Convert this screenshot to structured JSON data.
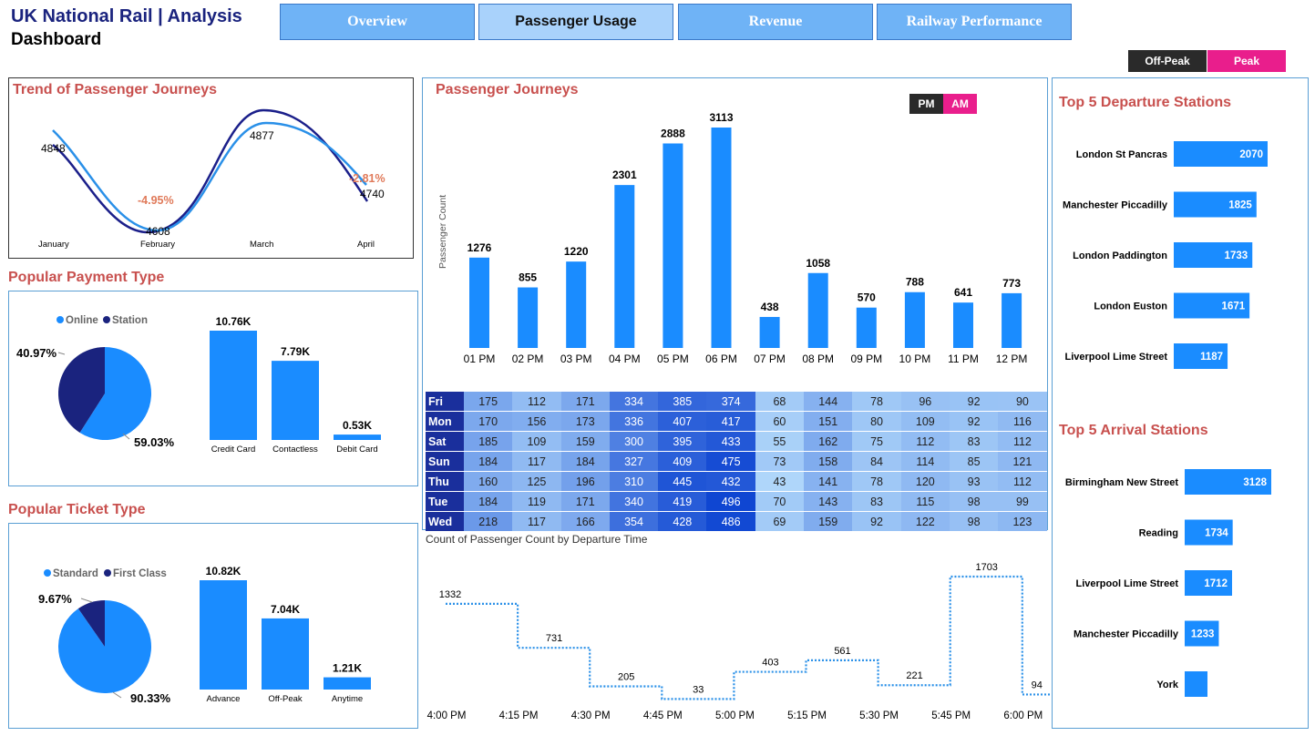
{
  "header": {
    "title_line1": "UK National Rail | Analysis",
    "title_line2": "Dashboard"
  },
  "nav": {
    "tabs": [
      {
        "label": "Overview",
        "active": false
      },
      {
        "label": "Passenger Usage",
        "active": true
      },
      {
        "label": "Revenue",
        "active": false
      },
      {
        "label": "Railway Performance",
        "active": false
      }
    ]
  },
  "peak_toggle": {
    "off_peak": "Off-Peak",
    "peak": "Peak"
  },
  "colors": {
    "accent": "#1a8cff",
    "navy": "#1a237e",
    "title_red": "#c8504e",
    "pink": "#e91e8c",
    "dark": "#2a2a2a"
  },
  "trend": {
    "title": "Trend of Passenger Journeys",
    "chart_data": {
      "type": "line",
      "categories": [
        "January",
        "February",
        "March",
        "April"
      ],
      "series": [
        {
          "values": [
            4848,
            4608,
            4877,
            4740
          ]
        }
      ],
      "labels": [
        "4848",
        "4608",
        "4877",
        "4740"
      ],
      "changes": [
        "-4.95%",
        "-2.81%"
      ]
    }
  },
  "payment": {
    "title": "Popular Payment Type",
    "legend": [
      "Online",
      "Station"
    ],
    "pie": {
      "type": "pie",
      "labels": [
        "Online",
        "Station"
      ],
      "values": [
        59.03,
        40.97
      ],
      "label_texts": [
        "59.03%",
        "40.97%"
      ]
    },
    "bars": {
      "type": "bar",
      "categories": [
        "Credit Card",
        "Contactless",
        "Debit Card"
      ],
      "values": [
        10.76,
        7.79,
        0.53
      ],
      "labels": [
        "10.76K",
        "7.79K",
        "0.53K"
      ]
    }
  },
  "ticket": {
    "title": "Popular Ticket Type",
    "legend": [
      "Standard",
      "First Class"
    ],
    "pie": {
      "type": "pie",
      "labels": [
        "Standard",
        "First Class"
      ],
      "values": [
        90.33,
        9.67
      ],
      "label_texts": [
        "90.33%",
        "9.67%"
      ]
    },
    "bars": {
      "type": "bar",
      "categories": [
        "Advance",
        "Off-Peak",
        "Anytime"
      ],
      "values": [
        10.82,
        7.04,
        1.21
      ],
      "labels": [
        "10.82K",
        "7.04K",
        "1.21K"
      ]
    }
  },
  "journeys": {
    "title": "Passenger Journeys",
    "toggle": {
      "pm": "PM",
      "am": "AM"
    },
    "chart_data": {
      "type": "bar",
      "ylabel": "Passenger Count",
      "categories": [
        "01 PM",
        "02 PM",
        "03 PM",
        "04 PM",
        "05 PM",
        "06 PM",
        "07 PM",
        "08 PM",
        "09 PM",
        "10 PM",
        "11 PM",
        "12 PM"
      ],
      "values": [
        1276,
        855,
        1220,
        2301,
        2888,
        3113,
        438,
        1058,
        570,
        788,
        641,
        773
      ]
    }
  },
  "heatmap": {
    "chart_data": {
      "type": "heatmap",
      "rows": [
        {
          "day": "Fri",
          "values": [
            175,
            112,
            171,
            334,
            385,
            374,
            68,
            144,
            78,
            96,
            92,
            90
          ]
        },
        {
          "day": "Mon",
          "values": [
            170,
            156,
            173,
            336,
            407,
            417,
            60,
            151,
            80,
            109,
            92,
            116
          ]
        },
        {
          "day": "Sat",
          "values": [
            185,
            109,
            159,
            300,
            395,
            433,
            55,
            162,
            75,
            112,
            83,
            112
          ]
        },
        {
          "day": "Sun",
          "values": [
            184,
            117,
            184,
            327,
            409,
            475,
            73,
            158,
            84,
            114,
            85,
            121
          ]
        },
        {
          "day": "Thu",
          "values": [
            160,
            125,
            196,
            310,
            445,
            432,
            43,
            141,
            78,
            120,
            93,
            112
          ]
        },
        {
          "day": "Tue",
          "values": [
            184,
            119,
            171,
            340,
            419,
            496,
            70,
            143,
            83,
            115,
            98,
            99
          ]
        },
        {
          "day": "Wed",
          "values": [
            218,
            117,
            166,
            354,
            428,
            486,
            69,
            159,
            92,
            122,
            98,
            123
          ]
        }
      ]
    }
  },
  "departure_time": {
    "title": "Count of Passenger Count by Departure Time",
    "chart_data": {
      "type": "line",
      "x": [
        "4:00 PM",
        "4:15 PM",
        "4:30 PM",
        "4:45 PM",
        "5:00 PM",
        "5:15 PM",
        "5:30 PM",
        "5:45 PM",
        "6:00 PM"
      ],
      "values": [
        1332,
        731,
        205,
        33,
        403,
        561,
        221,
        1703,
        94
      ],
      "labels": [
        "1332",
        "731",
        "205",
        "33",
        "403",
        "561",
        "221",
        "1703",
        "94"
      ]
    }
  },
  "departures": {
    "title": "Top 5 Departure Stations",
    "chart_data": {
      "type": "bar",
      "categories": [
        "London St Pancras",
        "Manchester Piccadilly",
        "London Paddington",
        "London Euston",
        "Liverpool Lime Street"
      ],
      "values": [
        2070,
        1825,
        1733,
        1671,
        1187
      ],
      "labels": [
        "2070",
        "1825",
        "1733",
        "1671",
        "1187"
      ]
    }
  },
  "arrivals": {
    "title": "Top 5 Arrival Stations",
    "chart_data": {
      "type": "bar",
      "categories": [
        "Birmingham New Street",
        "Reading",
        "Liverpool Lime Street",
        "Manchester Piccadilly",
        "York"
      ],
      "values": [
        3128,
        1734,
        1712,
        1233,
        0
      ],
      "labels": [
        "3128",
        "1734",
        "1712",
        "1233",
        ""
      ]
    }
  }
}
